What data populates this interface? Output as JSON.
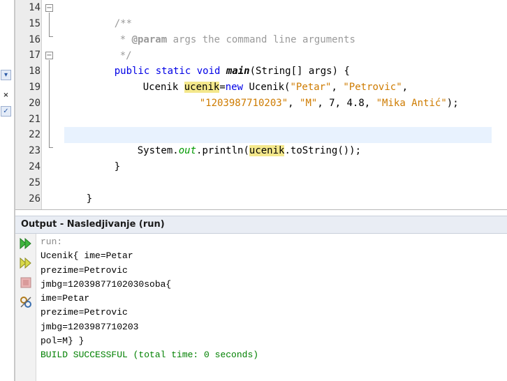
{
  "editor": {
    "line_numbers": [
      "14",
      "15",
      "16",
      "17",
      "18",
      "19",
      "20",
      "21",
      "22",
      "23",
      "24",
      "25",
      "26"
    ],
    "code": {
      "l14": "/**",
      "l15_star": "* ",
      "l15_tag": "@param",
      "l15_rest": " args the command line arguments",
      "l16": "*/",
      "l17_mods": "public static void ",
      "l17_name": "main",
      "l17_rest": "(String[] args) {",
      "l18_type": "Ucenik ",
      "l18_var": "ucenik",
      "l18_eq": "=",
      "l18_new": "new",
      "l18_call": " Ucenik(",
      "l18_s1": "\"Petar\"",
      "l18_sep": ", ",
      "l18_s2": "\"Petrovic\"",
      "l18_end": ",",
      "l19_s1": "\"1203987710203\"",
      "l19_sep1": ", ",
      "l19_s2": "\"M\"",
      "l19_nums": ", 7, 4.8, ",
      "l19_s3": "\"Mika Antić\"",
      "l19_end": ");",
      "l22_sys": "System.",
      "l22_out": "out",
      "l22_print": ".println(",
      "l22_var": "ucenik",
      "l22_rest": ".toString());",
      "l23": "}",
      "l25": "}"
    }
  },
  "output": {
    "title": "Output - Nasledjivanje (run)",
    "lines": {
      "run": "run:",
      "l1": "Ucenik{ ime=Petar",
      "l2": "prezime=Petrovic",
      "l3": "jmbg=12039877102030soba{",
      "l4": "ime=Petar",
      "l5": "prezime=Petrovic",
      "l6": "jmbg=1203987710203",
      "l7": "pol=M} }",
      "success": "BUILD SUCCESSFUL (total time: 0 seconds)"
    },
    "toolbar_icons": [
      "rerun-icon",
      "rerun-with-options-icon",
      "stop-icon",
      "settings-icon"
    ]
  },
  "colors": {
    "keyword": "#0000e6",
    "string": "#ce7b00",
    "highlight": "#f4e88c",
    "success": "#008000"
  }
}
